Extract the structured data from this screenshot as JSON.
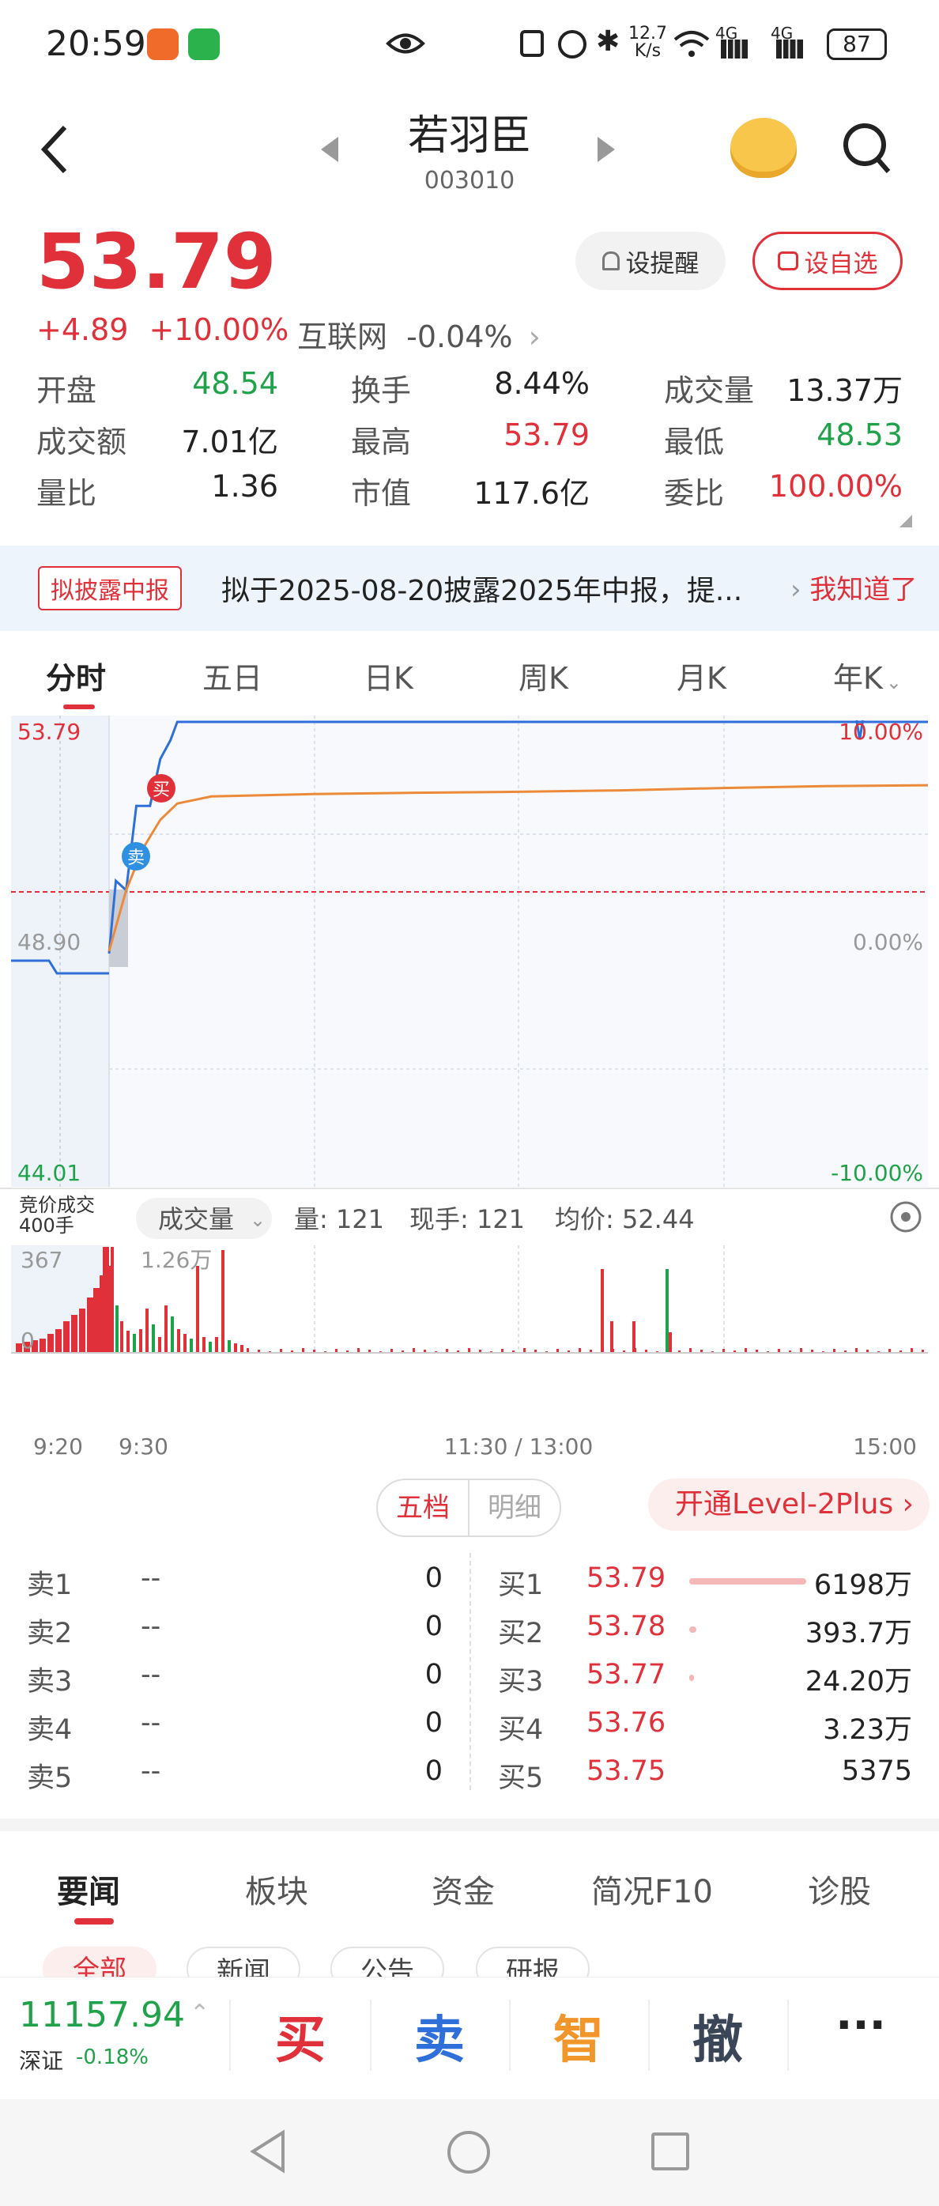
{
  "status": {
    "time": "20:59",
    "net_speed": "12.7",
    "net_unit": "K/s",
    "signal1": "4G",
    "signal2": "4G",
    "battery": "87"
  },
  "header": {
    "name": "若羽臣",
    "code": "003010"
  },
  "price": {
    "current": "53.79",
    "change": "+4.89",
    "change_pct": "+10.00%",
    "sector": "互联网",
    "sector_pct": "-0.04%"
  },
  "buttons": {
    "alert": "设提醒",
    "watch": "设自选"
  },
  "stats": [
    {
      "label": "开盘",
      "value": "48.54",
      "color": "#1fa24a"
    },
    {
      "label": "换手",
      "value": "8.44%",
      "color": "#222"
    },
    {
      "label": "成交量",
      "value": "13.37万",
      "color": "#222"
    },
    {
      "label": "成交额",
      "value": "7.01亿",
      "color": "#222"
    },
    {
      "label": "最高",
      "value": "53.79",
      "color": "#e0303a"
    },
    {
      "label": "最低",
      "value": "48.53",
      "color": "#1fa24a"
    },
    {
      "label": "量比",
      "value": "1.36",
      "color": "#222"
    },
    {
      "label": "市值",
      "value": "117.6亿",
      "color": "#222"
    },
    {
      "label": "委比",
      "value": "100.00%",
      "color": "#e0303a"
    }
  ],
  "notice": {
    "tag": "拟披露中报",
    "text": "拟于2025-08-20披露2025年中报，提...",
    "action": "我知道了"
  },
  "tabs": [
    "分时",
    "五日",
    "日K",
    "周K",
    "月K",
    "年K"
  ],
  "chart": {
    "y_top": "53.79",
    "y_mid": "48.90",
    "y_bottom": "44.01",
    "pct_top": "10.00%",
    "pct_mid": "0.00%",
    "pct_bottom": "-10.00%",
    "buy_mark": "买",
    "sell_mark": "卖",
    "auction_label1": "竞价成交",
    "auction_label2": "400手",
    "vol_selector": "成交量",
    "vol_info": "量: 121",
    "hand_info": "现手: 121",
    "avg_info": "均价: 52.44",
    "vol_max_left": "367",
    "vol_zero": "0",
    "vol_peak": "1.26万",
    "x_labels": [
      "9:20",
      "9:30",
      "11:30 / 13:00",
      "15:00"
    ]
  },
  "chart_data": {
    "type": "line",
    "title": "",
    "ylim": [
      44.01,
      53.79
    ],
    "series": [
      {
        "name": "",
        "x": [
          "9:30",
          "9:32",
          "9:35",
          "9:38",
          "9:42",
          "9:45",
          "9:48",
          "9:50",
          "10:00",
          "10:30",
          "11:00",
          "11:30",
          "13:30",
          "14:00",
          "14:30",
          "15:00"
        ],
        "values": [
          48.85,
          50.4,
          50.2,
          52.0,
          52.0,
          53.0,
          53.4,
          53.79,
          53.79,
          53.79,
          53.79,
          53.79,
          53.79,
          53.79,
          53.79,
          53.79
        ]
      },
      {
        "name": "",
        "x": [
          "9:30",
          "9:35",
          "9:40",
          "9:45",
          "9:50",
          "10:00",
          "10:30",
          "11:00",
          "11:30",
          "13:30",
          "14:00",
          "14:30",
          "15:00"
        ],
        "values": [
          48.9,
          50.2,
          51.1,
          51.7,
          52.05,
          52.2,
          52.25,
          52.28,
          52.3,
          52.33,
          52.38,
          52.42,
          52.44
        ]
      }
    ]
  },
  "orderbook": {
    "tab_active": "五档",
    "tab_other": "明细",
    "level2": "开通Level-2Plus",
    "sells": [
      {
        "label": "卖1",
        "price": "--",
        "vol": "0"
      },
      {
        "label": "卖2",
        "price": "--",
        "vol": "0"
      },
      {
        "label": "卖3",
        "price": "--",
        "vol": "0"
      },
      {
        "label": "卖4",
        "price": "--",
        "vol": "0"
      },
      {
        "label": "卖5",
        "price": "--",
        "vol": "0"
      }
    ],
    "buys": [
      {
        "label": "买1",
        "price": "53.79",
        "vol": "6198万",
        "fill": 1.0
      },
      {
        "label": "买2",
        "price": "53.78",
        "vol": "393.7万",
        "fill": 0.06
      },
      {
        "label": "买3",
        "price": "53.77",
        "vol": "24.20万",
        "fill": 0.01
      },
      {
        "label": "买4",
        "price": "53.76",
        "vol": "3.23万",
        "fill": 0.0
      },
      {
        "label": "买5",
        "price": "53.75",
        "vol": "5375",
        "fill": 0.0
      }
    ]
  },
  "news": {
    "tabs": [
      "要闻",
      "板块",
      "资金",
      "简况F10",
      "诊股"
    ],
    "subtabs": [
      "全部",
      "新闻",
      "公告",
      "研报"
    ]
  },
  "bottom": {
    "index_value": "11157.94",
    "index_name": "深证",
    "index_pct": "-0.18%",
    "buy": "买",
    "sell": "卖",
    "smart": "智",
    "cancel": "撤",
    "more": "···"
  }
}
